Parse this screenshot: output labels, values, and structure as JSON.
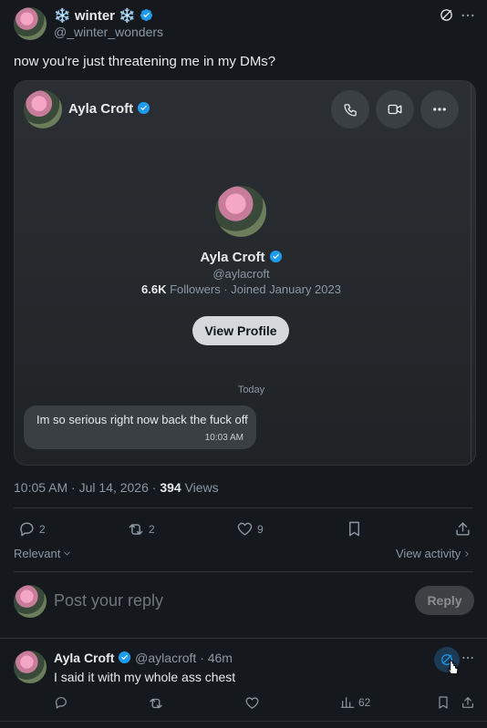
{
  "post": {
    "author_name": "❄️ winter ❄️",
    "author_handle": "@_winter_wonders",
    "text": "now you're just threatening me in my DMs?",
    "timestamp": "10:05 AM · Jul 14, 2026 ·",
    "views_count": "394",
    "views_label": "Views"
  },
  "dm_card": {
    "header_name": "Ayla Croft",
    "profile_name": "Ayla Croft",
    "profile_handle": "@aylacroft",
    "followers_count": "6.6K",
    "followers_label": "Followers · Joined January 2023",
    "view_profile_label": "View Profile",
    "date_separator": "Today",
    "message_text": "Im so serious right now back the fuck off",
    "message_time": "10:03 AM"
  },
  "actions": {
    "replies": "2",
    "reposts": "2",
    "likes": "9"
  },
  "filters": {
    "sort_label": "Relevant",
    "activity_label": "View activity"
  },
  "composer": {
    "placeholder": "Post your reply",
    "reply_label": "Reply"
  },
  "reply": {
    "author_name": "Ayla Croft",
    "author_handle": "@aylacroft",
    "time": "· 46m",
    "text": "I said it with my whole ass chest",
    "views": "62"
  },
  "colors": {
    "background": "#15181c",
    "verified": "#1d9bf0",
    "card_bg": "#202326",
    "bubble_bg": "#3a3f44"
  }
}
